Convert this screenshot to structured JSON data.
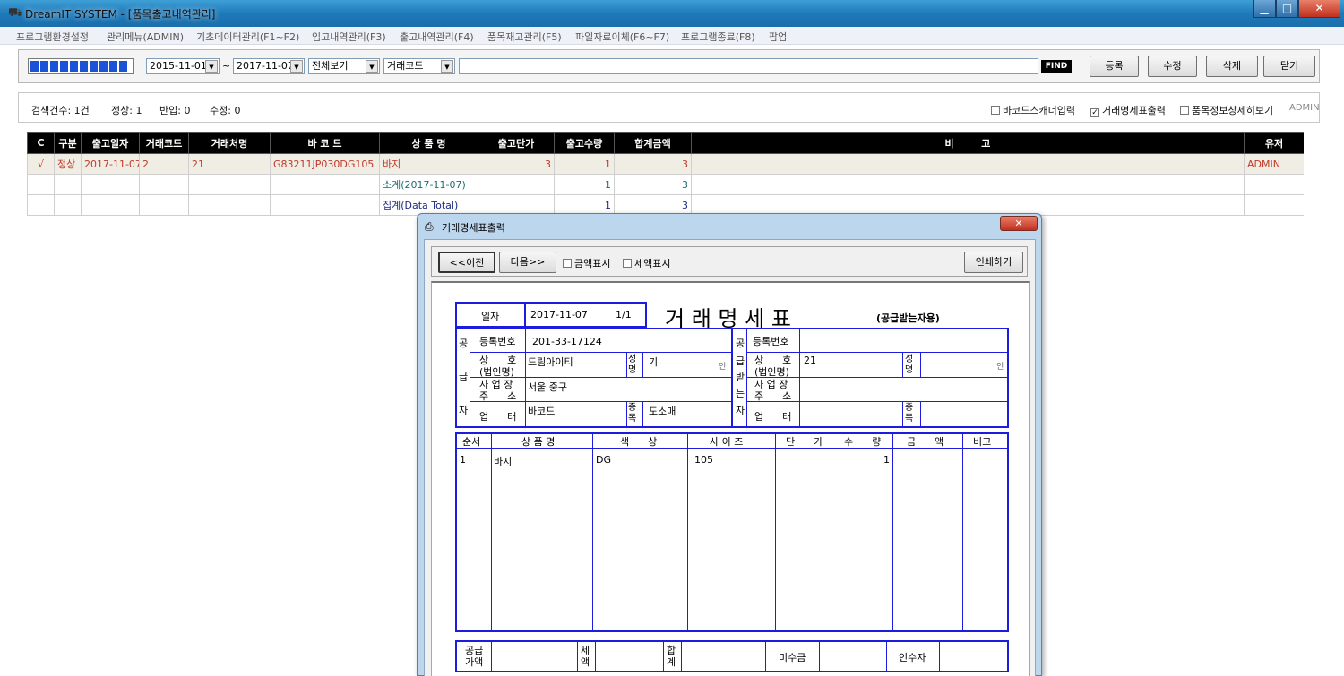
{
  "window": {
    "title": "DreamIT SYSTEM - [품목출고내역관리]",
    "min": "▁",
    "max": "□",
    "close": "✕"
  },
  "menu": [
    "프로그램환경설정",
    "관리메뉴(ADMIN)",
    "기초데이터관리(F1~F2)",
    "입고내역관리(F3)",
    "출고내역관리(F4)",
    "품목재고관리(F5)",
    "파일자료이체(F6~F7)",
    "프로그램종료(F8)",
    "팝업"
  ],
  "toolbar": {
    "date_from": "2015-11-01",
    "tilde": "~",
    "date_to": "2017-11-07",
    "view": "전체보기",
    "field": "거래코드",
    "search_value": "",
    "find": "FIND",
    "buttons": {
      "register": "등록",
      "edit": "수정",
      "delete": "삭제",
      "close": "닫기"
    }
  },
  "status": {
    "count": "검색건수: 1건",
    "normal": "정상: 1",
    "returned": "반입: 0",
    "modified": "수정: 0",
    "barcode_scanner": "바코드스캐너입력",
    "print_statement": "거래명세표출력",
    "detail_view": "품목정보상세히보기",
    "user": "ADMIN"
  },
  "grid": {
    "headers": [
      "C",
      "구분",
      "출고일자",
      "거래코드",
      "거래처명",
      "바 코 드",
      "상 품 명",
      "출고단가",
      "출고수량",
      "합계금액",
      "비        고",
      "유저"
    ],
    "rows": [
      [
        "√",
        "정상",
        "2017-11-07",
        "2",
        "21",
        "G83211JP030DG105",
        "바지",
        "3",
        "1",
        "3",
        "",
        "ADMIN"
      ],
      [
        "",
        "",
        "",
        "",
        "",
        "",
        "소계(2017-11-07)",
        "",
        "1",
        "3",
        "",
        ""
      ],
      [
        "",
        "",
        "",
        "",
        "",
        "",
        "집계(Data Total)",
        "",
        "1",
        "3",
        "",
        ""
      ]
    ]
  },
  "dialog": {
    "title": "거래명세표출력",
    "close": "✕",
    "prev": "<<이전",
    "next": "다음>>",
    "show_amount": "금액표시",
    "show_tax": "세액표시",
    "print": "인쇄하기",
    "statement": {
      "date_label": "일자",
      "date": "2017-11-07",
      "page": "1/1",
      "heading": "거 래 명 세 표",
      "subheading": "(공급받는자용)",
      "supplier_label": [
        "공",
        "급",
        "자"
      ],
      "receiver_label": [
        "공",
        "급",
        "받",
        "는",
        "자"
      ],
      "reg_no_label": "등록번호",
      "trade_name_label": "상      호",
      "corp_name_label": "(법인명)",
      "owner_label": "성명",
      "address_label": "사 업 장",
      "address_label2": "주      소",
      "type_label": "업      태",
      "item_label": "종목",
      "seal": "인",
      "supplier": {
        "reg_no": "201-33-17124",
        "trade_name": "드림아이티",
        "owner": "기",
        "address": "서울 중구",
        "type": "바코드",
        "item": "도소매"
      },
      "receiver": {
        "reg_no": "",
        "trade_name": "21",
        "owner": "",
        "address": "",
        "type": "",
        "item": ""
      },
      "item_headers": [
        "순서",
        "상 품 명",
        "색      상",
        "사 이 즈",
        "단      가",
        "수      량",
        "금      액",
        "비고"
      ],
      "items": [
        [
          "1",
          "바지",
          "DG",
          "105",
          "",
          "1",
          "",
          ""
        ]
      ],
      "footer": {
        "supply": "공급",
        "supply2": "가액",
        "tax": "세",
        "tax2": "액",
        "total": "합",
        "total2": "계",
        "unpaid": "미수금",
        "receiver": "인수자"
      }
    }
  }
}
